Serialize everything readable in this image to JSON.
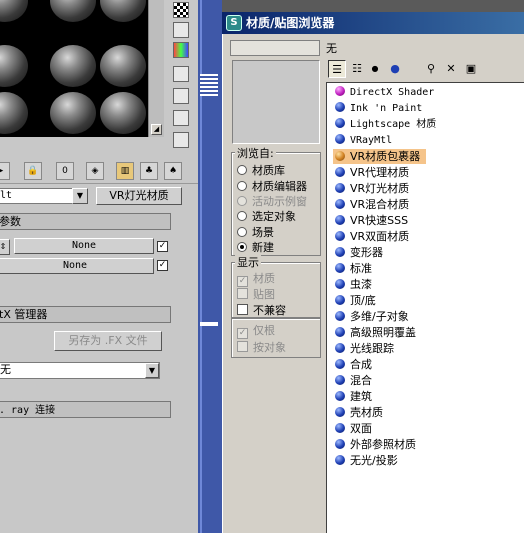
{
  "dialog": {
    "title": "材质/贴图浏览器",
    "title_icon": "S",
    "name_value": "无"
  },
  "browse_from": {
    "label": "浏览自:",
    "options": [
      {
        "label": "材质库",
        "selected": false,
        "enabled": true
      },
      {
        "label": "材质编辑器",
        "selected": false,
        "enabled": true
      },
      {
        "label": "活动示例窗",
        "selected": false,
        "enabled": false
      },
      {
        "label": "选定对象",
        "selected": false,
        "enabled": true
      },
      {
        "label": "场景",
        "selected": false,
        "enabled": true
      },
      {
        "label": "新建",
        "selected": true,
        "enabled": true
      }
    ]
  },
  "show": {
    "label": "显示",
    "options": [
      {
        "label": "材质",
        "checked": true,
        "enabled": false
      },
      {
        "label": "贴图",
        "checked": false,
        "enabled": false
      },
      {
        "label": "不兼容",
        "checked": false,
        "enabled": true
      }
    ]
  },
  "extra_options": [
    {
      "label": "仅根",
      "checked": true,
      "enabled": false
    },
    {
      "label": "按对象",
      "checked": false,
      "enabled": false
    }
  ],
  "materials": [
    {
      "label": "DirectX Shader",
      "color": "magenta",
      "mono": true
    },
    {
      "label": "Ink 'n Paint",
      "color": "blue",
      "mono": true
    },
    {
      "label": "Lightscape 材质",
      "color": "blue",
      "mono": true
    },
    {
      "label": "VRayMtl",
      "color": "blue",
      "mono": true
    },
    {
      "label": "VR材质包裹器",
      "color": "orange",
      "selected": true
    },
    {
      "label": "VR代理材质",
      "color": "blue"
    },
    {
      "label": "VR灯光材质",
      "color": "blue"
    },
    {
      "label": "VR混合材质",
      "color": "blue"
    },
    {
      "label": "VR快速SSS",
      "color": "blue"
    },
    {
      "label": "VR双面材质",
      "color": "blue"
    },
    {
      "label": "变形器",
      "color": "blue"
    },
    {
      "label": "标准",
      "color": "blue"
    },
    {
      "label": "虫漆",
      "color": "blue"
    },
    {
      "label": "顶/底",
      "color": "blue"
    },
    {
      "label": "多维/子对象",
      "color": "blue"
    },
    {
      "label": "高级照明覆盖",
      "color": "blue"
    },
    {
      "label": "光线跟踪",
      "color": "blue"
    },
    {
      "label": "合成",
      "color": "blue"
    },
    {
      "label": "混合",
      "color": "blue"
    },
    {
      "label": "建筑",
      "color": "blue"
    },
    {
      "label": "壳材质",
      "color": "blue"
    },
    {
      "label": "双面",
      "color": "blue"
    },
    {
      "label": "外部参照材质",
      "color": "blue"
    },
    {
      "label": "无光/投影",
      "color": "blue"
    }
  ],
  "editor": {
    "material_name": "lt",
    "material_type_button": "VR灯光材质",
    "params_rollout": "参数",
    "map_none_1": "None",
    "map_none_2": "None",
    "fx_rollout": "tX 管理器",
    "save_fx_button": "另存为 .FX 文件",
    "dropdown_value": "无",
    "ray_rollout": ". ray 连接"
  }
}
